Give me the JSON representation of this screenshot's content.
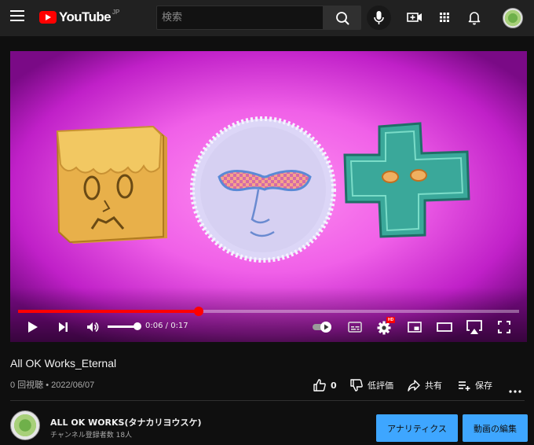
{
  "header": {
    "logo_text": "YouTube",
    "logo_region": "JP",
    "search_placeholder": "検索"
  },
  "player": {
    "current_time": "0:06",
    "duration": "0:17",
    "time_separator": " / ",
    "progress_fraction": 0.36,
    "settings_badge": "HD"
  },
  "video": {
    "title": "All OK Works_Eternal",
    "views": "0 回視聴",
    "date": "2022/06/07",
    "likes": "0",
    "dislike_label": "低評価",
    "share_label": "共有",
    "save_label": "保存"
  },
  "channel": {
    "name": "ALL OK WORKS(タナカリヨウスケ)",
    "subscribers": "チャンネル登録者数 18人",
    "analytics_button": "アナリティクス",
    "edit_button": "動画の編集"
  },
  "colors": {
    "accent_blue": "#3ea6ff",
    "brand_red": "#ff0000",
    "background": "#0f0f0f",
    "masthead": "#212121"
  },
  "icons": [
    "menu-icon",
    "youtube-logo",
    "search-icon",
    "mic-icon",
    "create-video-icon",
    "apps-grid-icon",
    "bell-icon",
    "avatar",
    "play-icon",
    "next-icon",
    "volume-icon",
    "autoplay-toggle-icon",
    "subtitles-icon",
    "settings-gear-icon",
    "miniplayer-icon",
    "theater-icon",
    "airplay-icon",
    "fullscreen-icon",
    "like-icon",
    "dislike-icon",
    "share-icon",
    "save-playlist-icon",
    "more-icon"
  ]
}
